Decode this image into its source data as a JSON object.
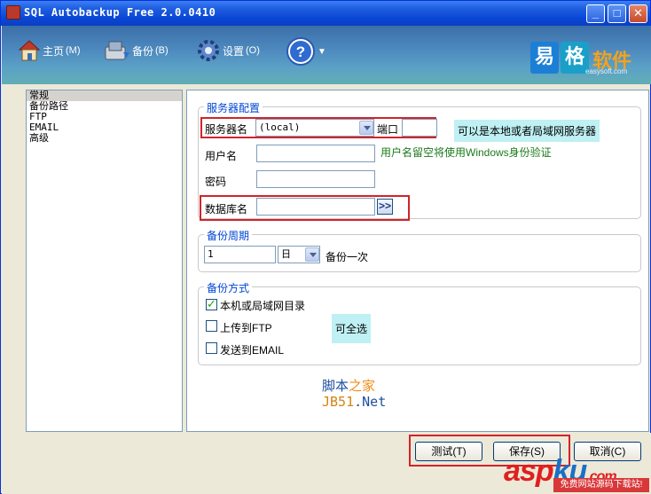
{
  "window": {
    "title": "SQL Autobackup Free 2.0.0410",
    "minimize": "_",
    "maximize": "□",
    "close": "✕"
  },
  "toolbar": {
    "home_label": "主页",
    "home_key": "(M)",
    "backup_label": "备份",
    "backup_key": "(B)",
    "settings_label": "设置",
    "settings_key": "(O)",
    "help_symbol": "?",
    "help_dropdown": "▼"
  },
  "logo": {
    "char1": "易",
    "char2": "格",
    "rest": "软件",
    "sub": "easysoft.com"
  },
  "nav": {
    "items": [
      "常规",
      "备份路径",
      "FTP",
      "EMAIL",
      "高级"
    ],
    "selected": 0
  },
  "server": {
    "group_title": "服务器配置",
    "server_label": "服务器名",
    "server_value": "(local)",
    "port_label": "端口",
    "port_value": "",
    "server_hint": "可以是本地或者局域网服务器",
    "user_label": "用户名",
    "user_value": "",
    "user_hint": "用户名留空将使用Windows身份验证",
    "password_label": "密码",
    "password_value": "",
    "db_label": "数据库名",
    "db_value": "",
    "browse_symbol": ">>"
  },
  "period": {
    "group_title": "备份周期",
    "count_value": "1",
    "unit_value": "日",
    "suffix": "备份一次"
  },
  "method": {
    "group_title": "备份方式",
    "local_label": "本机或局域网目录",
    "local_checked": true,
    "ftp_label": "上传到FTP",
    "ftp_checked": false,
    "email_label": "发送到EMAIL",
    "email_checked": false,
    "hint": "可全选"
  },
  "watermark": {
    "line1_a": "脚本",
    "line1_b": "之家",
    "line2_a": "JB51",
    "line2_b": ".Net",
    "aspku_r": "asp",
    "aspku_b": "ku",
    "aspku_dot": ".com",
    "aspku_sub": "免费网站源码下载站!"
  },
  "buttons": {
    "test": "测试(T)",
    "save": "保存(S)",
    "cancel": "取消(C)"
  }
}
